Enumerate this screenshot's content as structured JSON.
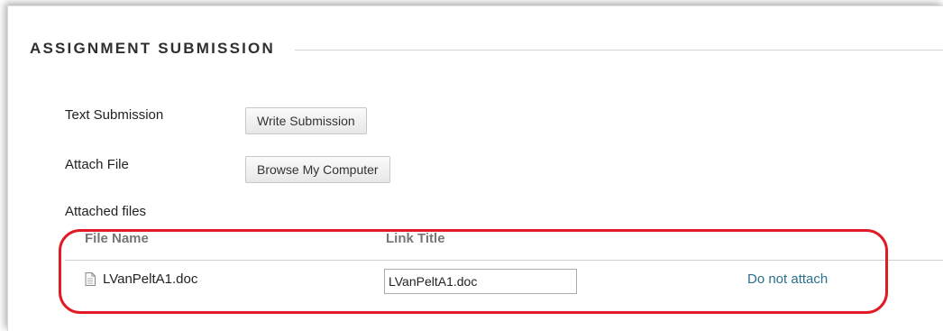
{
  "section": {
    "title": "ASSIGNMENT SUBMISSION"
  },
  "text_submission": {
    "label": "Text Submission",
    "button": "Write Submission"
  },
  "attach_file": {
    "label": "Attach File",
    "button": "Browse My Computer"
  },
  "attached_files": {
    "label": "Attached files",
    "columns": [
      "File Name",
      "Link Title"
    ],
    "rows": [
      {
        "file_name": "LVanPeltA1.doc",
        "link_title": "LVanPeltA1.doc",
        "action": "Do not attach"
      }
    ]
  },
  "colors": {
    "accent_link": "#2c6f8e",
    "highlight": "#e01b24"
  },
  "icons": {
    "file": "document-icon"
  }
}
